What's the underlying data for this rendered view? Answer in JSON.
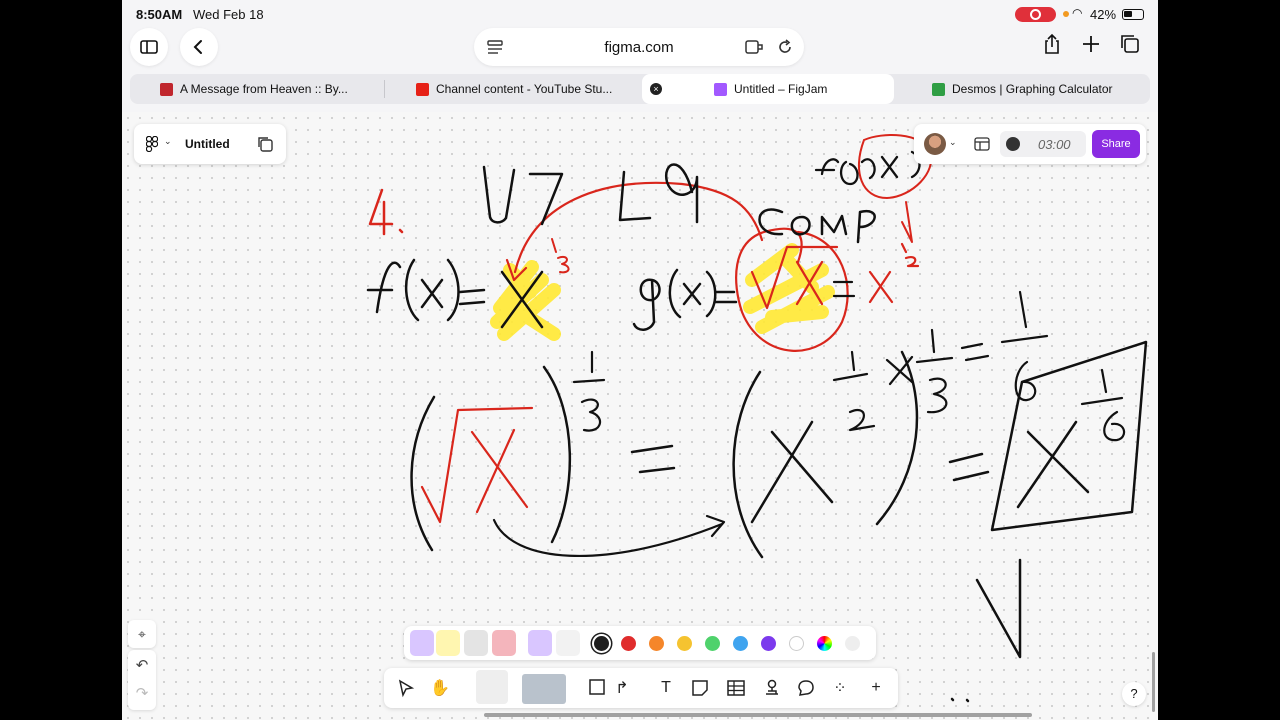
{
  "status_bar": {
    "time": "8:50AM",
    "date": "Wed Feb 18",
    "battery": "42%"
  },
  "browser": {
    "url": "figma.com",
    "tabs": [
      {
        "label": "A Message from Heaven :: By...",
        "favicon_color": "#c0262d"
      },
      {
        "label": "Channel content - YouTube Stu...",
        "favicon_color": "#e62117"
      },
      {
        "label": "Untitled – FigJam",
        "favicon_color": "#a259ff",
        "active": true
      },
      {
        "label": "Desmos | Graphing Calculator",
        "favicon_color": "#2f9e44"
      }
    ]
  },
  "figjam": {
    "file_title": "Untitled",
    "timer": "03:00",
    "share_label": "Share",
    "help_label": "?",
    "accent_color": "#8a2be2"
  },
  "palette": {
    "colors": [
      "#1e1e1e",
      "#e02c2c",
      "#f5862a",
      "#f5c330",
      "#4fd26c",
      "#3fa4ef",
      "#7c3aed",
      "#ffffff"
    ]
  },
  "toolbar": {
    "tools": [
      "move-icon",
      "hand-icon",
      "marker-icon",
      "shapes-icon",
      "text-icon",
      "sticky-icon",
      "table-icon",
      "stamp-icon",
      "comment-icon",
      "more-icon",
      "add-icon"
    ]
  }
}
